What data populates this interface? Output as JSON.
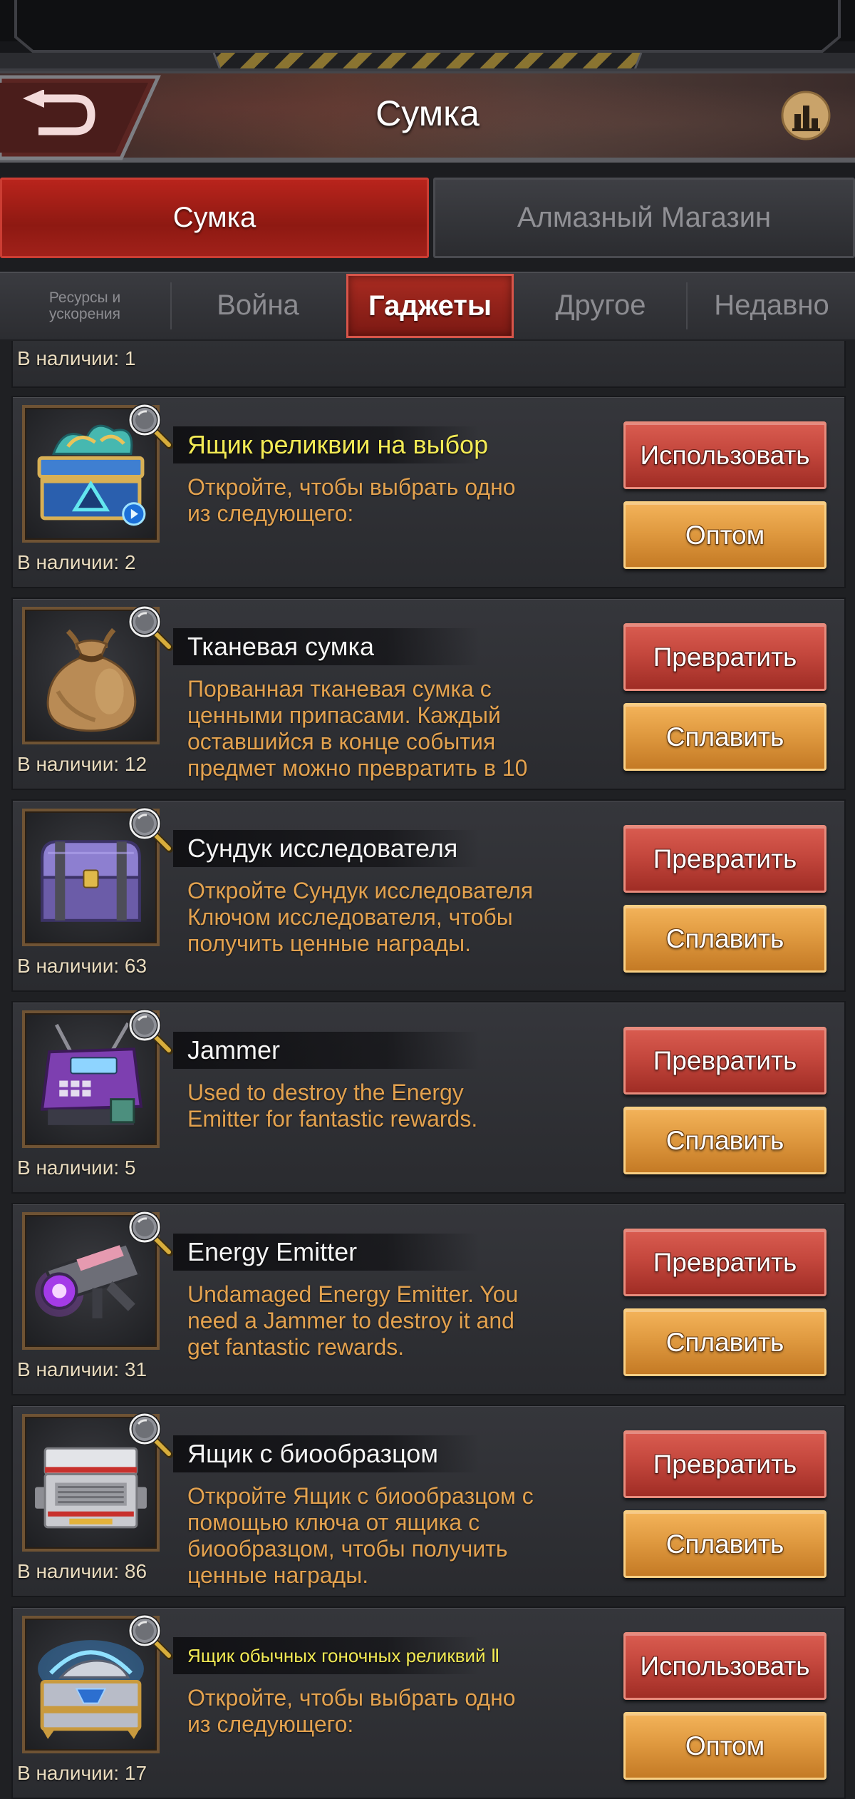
{
  "header": {
    "title": "Сумка",
    "back_icon": "back-arrow-icon",
    "stats_icon": "bar-chart-icon"
  },
  "tabs": [
    {
      "label": "Сумка",
      "active": true
    },
    {
      "label": "Алмазный Магазин",
      "active": false
    }
  ],
  "subtabs": [
    {
      "label": "Ресурсы и\nускорения",
      "active": false
    },
    {
      "label": "Война",
      "active": false
    },
    {
      "label": "Гаджеты",
      "active": true
    },
    {
      "label": "Другое",
      "active": false
    },
    {
      "label": "Недавно",
      "active": false
    }
  ],
  "partial_item": {
    "count": "В наличии: 1"
  },
  "items": [
    {
      "icon": "relic-chest-icon",
      "title": "Ящик реликвии на выбор",
      "title_color": "#f2ea55",
      "description": "Откройте, чтобы выбрать одно\nиз следующего:",
      "count": "В наличии: 2",
      "primary_button": "Использовать",
      "secondary_button": "Оптом"
    },
    {
      "icon": "cloth-bag-icon",
      "title": "Тканевая сумка",
      "title_color": "#f4f4f4",
      "description": "Порванная тканевая сумка с\nценными припасами. Каждый\nоставшийся в конце события\nпредмет можно превратить в 10",
      "count": "В наличии: 12",
      "primary_button": "Превратить",
      "secondary_button": "Сплавить"
    },
    {
      "icon": "explorer-chest-icon",
      "title": "Сундук исследователя",
      "title_color": "#f4f4f4",
      "description": "Откройте Сундук исследователя\nКлючом исследователя, чтобы\nполучить ценные награды.",
      "count": "В наличии: 63",
      "primary_button": "Превратить",
      "secondary_button": "Сплавить"
    },
    {
      "icon": "jammer-icon",
      "title": "Jammer",
      "title_color": "#f4f4f4",
      "description": "Used to destroy the Energy\nEmitter for fantastic rewards.",
      "count": "В наличии: 5",
      "primary_button": "Превратить",
      "secondary_button": "Сплавить"
    },
    {
      "icon": "energy-emitter-icon",
      "title": "Energy Emitter",
      "title_color": "#f4f4f4",
      "description": "Undamaged Energy Emitter. You\nneed a Jammer to destroy it and\nget fantastic rewards.",
      "count": "В наличии: 31",
      "primary_button": "Превратить",
      "secondary_button": "Сплавить"
    },
    {
      "icon": "biosample-box-icon",
      "title": "Ящик с биообразцом",
      "title_color": "#f4f4f4",
      "description": "Откройте Ящик с биообразцом с\nпомощью ключа от ящика с\nбиообразцом, чтобы получить\nценные награды.",
      "count": "В наличии: 86",
      "primary_button": "Превратить",
      "secondary_button": "Сплавить"
    },
    {
      "icon": "racing-relic-chest-icon",
      "title": "Ящик обычных гоночных реликвий Ⅱ",
      "title_color": "#f2ea55",
      "description": "Откройте, чтобы выбрать одно\nиз следующего:",
      "count": "В наличии: 17",
      "primary_button": "Использовать",
      "secondary_button": "Оптом"
    }
  ],
  "colors": {
    "active_tab_red": "#a8241d",
    "button_red": "#c4473d",
    "button_orange": "#e09a40",
    "description_text": "#e3a24f",
    "highlight_title": "#f2ea55"
  }
}
